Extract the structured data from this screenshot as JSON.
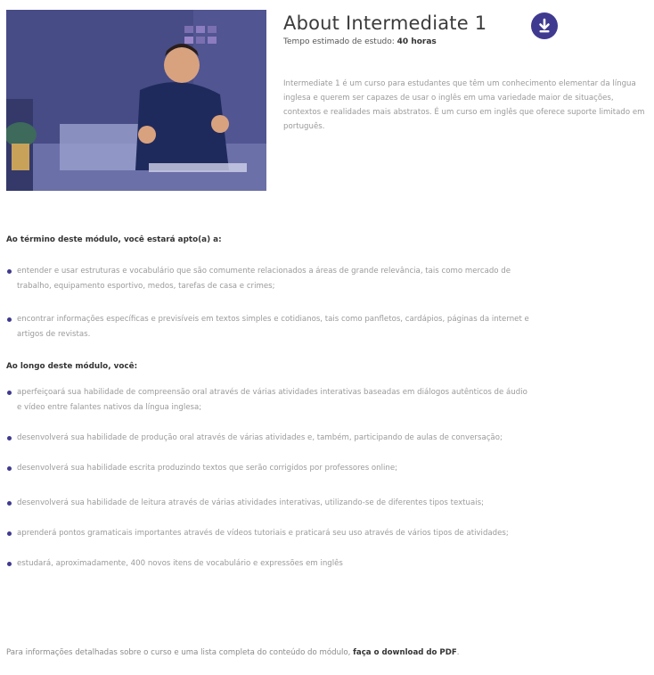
{
  "course": {
    "title": "About Intermediate 1",
    "study_time_label": "Tempo estimado de estudo: ",
    "study_time_value": "40 horas",
    "description": "Intermediate 1 é um curso para estudantes que têm um conhecimento elementar da língua inglesa e querem ser capazes de usar o inglês em uma variedade maior de situações, contextos e realidades mais abstratos. É um curso em inglês que oferece suporte limitado em português."
  },
  "icons": {
    "download": "download-icon",
    "accent_color": "#3f3a8f"
  },
  "outcomes": {
    "heading": "Ao término deste módulo, você estará apto(a) a:",
    "items": [
      "entender e usar estruturas e vocabulário que são comumente relacionados a áreas de grande relevância, tais como mercado de trabalho, equipamento esportivo, medos, tarefas de casa e crimes;",
      "encontrar informações específicas e previsíveis em textos simples e cotidianos, tais como panfletos, cardápios, páginas da internet e artigos de revistas."
    ]
  },
  "activities": {
    "heading": "Ao longo deste módulo, você:",
    "items": [
      "aperfeiçoará sua habilidade de compreensão oral através de várias atividades interativas baseadas em diálogos autênticos de áudio e vídeo entre falantes nativos da língua inglesa;",
      "desenvolverá sua habilidade de produção oral através de várias atividades e, também, participando de aulas de conversação;",
      "desenvolverá sua habilidade escrita produzindo textos que serão corrigidos por professores online;",
      "desenvolverá sua habilidade de leitura através de várias atividades interativas, utilizando-se de diferentes tipos textuais;",
      "aprenderá pontos gramaticais importantes através de vídeos tutoriais e praticará seu uso através de vários tipos de atividades;",
      "estudará, aproximadamente, 400 novos itens de vocabulário e expressões em inglês"
    ]
  },
  "footer": {
    "text": "Para informações detalhadas sobre o curso e uma lista completa do conteúdo do módulo, ",
    "link": "faça o download do PDF",
    "end": "."
  }
}
